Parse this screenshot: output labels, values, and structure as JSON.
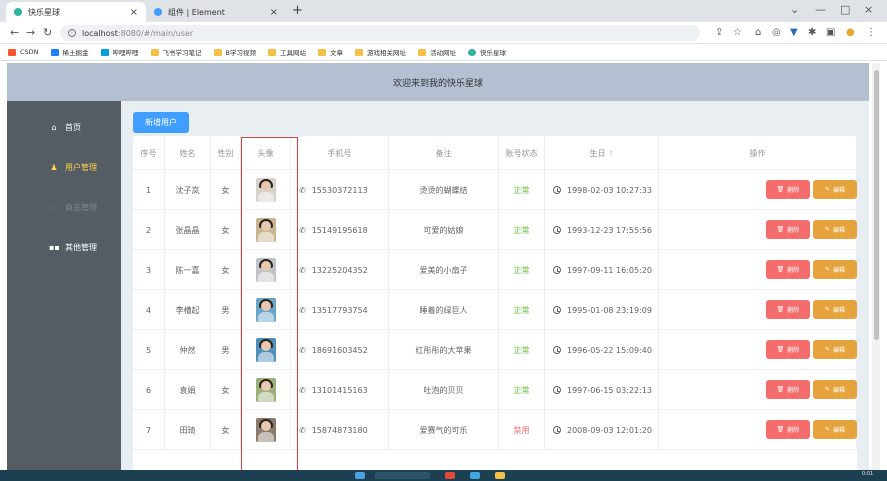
{
  "browser": {
    "tabs": [
      {
        "title": "快乐星球",
        "active": true,
        "favicon_color": "#2fb3a0"
      },
      {
        "title": "组件 | Element",
        "active": false,
        "favicon_color": "#409eff"
      }
    ],
    "url_host": "localhost",
    "url_rest": ":8080/#/main/user",
    "bookmarks": [
      {
        "label": "CSDN",
        "icon": "csdn-icon",
        "color": "#fc5531"
      },
      {
        "label": "稀土掘金",
        "icon": "juejin-icon",
        "color": "#1e80ff"
      },
      {
        "label": "哔哩哔哩",
        "icon": "bilibili-icon",
        "color": "#00a1d6"
      },
      {
        "label": "飞书学习笔记",
        "icon": "folder-icon"
      },
      {
        "label": "B学习视频",
        "icon": "folder-icon"
      },
      {
        "label": "工具网站",
        "icon": "folder-icon"
      },
      {
        "label": "文章",
        "icon": "folder-icon"
      },
      {
        "label": "游戏相关网址",
        "icon": "folder-icon"
      },
      {
        "label": "活动网址",
        "icon": "folder-icon"
      },
      {
        "label": "快乐星球",
        "icon": "globe-icon",
        "color": "#2fb3a0"
      }
    ]
  },
  "app": {
    "header_title": "欢迎来到我的快乐星球",
    "menu": [
      {
        "label": "首页",
        "icon": "home-icon",
        "state": "normal"
      },
      {
        "label": "用户管理",
        "icon": "user-icon",
        "state": "active"
      },
      {
        "label": "商品管理",
        "icon": "goods-icon",
        "state": "dim"
      },
      {
        "label": "其他管理",
        "icon": "grid-icon",
        "state": "normal"
      }
    ],
    "add_button": "新增用户",
    "table": {
      "columns": [
        "序号",
        "姓名",
        "性别",
        "头像",
        "手机号",
        "备注",
        "账号状态",
        "生日",
        "操作"
      ],
      "sort_glyph": "⇕",
      "rows": [
        {
          "id": "1",
          "name": "沈子岚",
          "gender": "女",
          "phone": "15530372113",
          "note": "烫烫的蝴蝶结",
          "status": "正常",
          "birthday": "1998-02-03 10:27:33",
          "avatar_color": "#d7d2cc"
        },
        {
          "id": "2",
          "name": "张晶晶",
          "gender": "女",
          "phone": "15149195618",
          "note": "可爱的姑娘",
          "status": "正常",
          "birthday": "1993-12-23 17:55:56",
          "avatar_color": "#c9b58f"
        },
        {
          "id": "3",
          "name": "陈一嘉",
          "gender": "女",
          "phone": "13225204352",
          "note": "爱美的小扇子",
          "status": "正常",
          "birthday": "1997-09-11 16:05:20",
          "avatar_color": "#bfc4c8"
        },
        {
          "id": "4",
          "name": "李槽起",
          "gender": "男",
          "phone": "13517793754",
          "note": "睡着的绿巨人",
          "status": "正常",
          "birthday": "1995-01-08 23:19:09",
          "avatar_color": "#6aa4c8"
        },
        {
          "id": "5",
          "name": "仲然",
          "gender": "男",
          "phone": "18691603452",
          "note": "红彤彤的大苹果",
          "status": "正常",
          "birthday": "1996-05-22 15:09:40",
          "avatar_color": "#4f8fb8"
        },
        {
          "id": "6",
          "name": "袁娟",
          "gender": "女",
          "phone": "13101415163",
          "note": "吐泡的贝贝",
          "status": "正常",
          "birthday": "1997-06-15 03:22:13",
          "avatar_color": "#9ab27a"
        },
        {
          "id": "7",
          "name": "田琦",
          "gender": "女",
          "phone": "15874873180",
          "note": "爱赛气的可乐",
          "status": "禁用",
          "birthday": "2008-09-03 12:01:20",
          "avatar_color": "#8a7a6a"
        }
      ],
      "delete_label": "删除",
      "edit_label": "编辑"
    }
  },
  "taskbar": {
    "time": "0:01"
  },
  "colors": {
    "primary": "#409eff",
    "danger": "#f56c6c",
    "warning": "#e6a23c",
    "success": "#67c23a",
    "aside": "#545c64",
    "header": "#b3c0d1",
    "menu_active": "#ffd04b"
  }
}
